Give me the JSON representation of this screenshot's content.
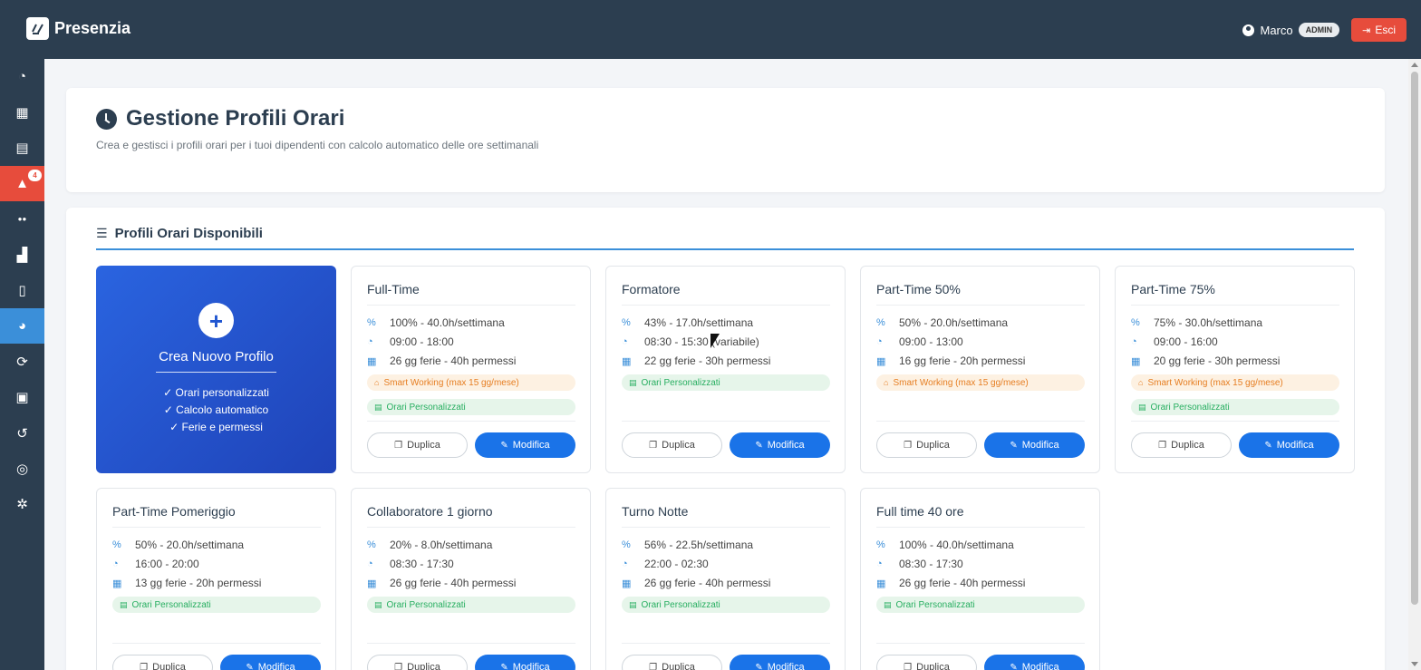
{
  "app": {
    "brand": "Presenzia"
  },
  "header": {
    "user_name": "Marco",
    "role_badge": "ADMIN",
    "exit_label": "Esci"
  },
  "sidebar": {
    "items": [
      {
        "icon": "dashboard-icon",
        "glyph": "◔"
      },
      {
        "icon": "calendar-icon",
        "glyph": "▦"
      },
      {
        "icon": "clipboard-icon",
        "glyph": "▤"
      },
      {
        "icon": "alert-icon",
        "glyph": "▲",
        "badge": "4"
      },
      {
        "icon": "users-icon",
        "glyph": "●●"
      },
      {
        "icon": "chart-icon",
        "glyph": "▟"
      },
      {
        "icon": "invoice-icon",
        "glyph": "▯"
      },
      {
        "icon": "user-clock-icon",
        "glyph": "◕"
      },
      {
        "icon": "sync-icon",
        "glyph": "⟳"
      },
      {
        "icon": "qr-icon",
        "glyph": "▣"
      },
      {
        "icon": "history-icon",
        "glyph": "↺"
      },
      {
        "icon": "support-icon",
        "glyph": "◎"
      },
      {
        "icon": "settings-icon",
        "glyph": "✲"
      }
    ]
  },
  "page": {
    "title": "Gestione Profili Orari",
    "subtitle": "Crea e gestisci i profili orari per i tuoi dipendenti con calcolo automatico delle ore settimanali"
  },
  "section": {
    "title": "Profili Orari Disponibili"
  },
  "create_card": {
    "title": "Crea Nuovo Profilo",
    "features": [
      "Orari personalizzati",
      "Calcolo automatico",
      "Ferie e permessi"
    ]
  },
  "buttons": {
    "duplicate": "Duplica",
    "edit": "Modifica"
  },
  "tags": {
    "smart_working": "Smart Working (max 15 gg/mese)",
    "custom_hours": "Orari Personalizzati"
  },
  "profiles": [
    {
      "name": "Full-Time",
      "percent": "100% - 40.0h/settimana",
      "hours": "09:00 - 18:00",
      "leave": "26 gg ferie - 40h permessi",
      "smart_working": true
    },
    {
      "name": "Formatore",
      "percent": "43% - 17.0h/settimana",
      "hours": "08:30 - 15:30 (variabile)",
      "leave": "22 gg ferie - 30h permessi",
      "smart_working": false
    },
    {
      "name": "Part-Time 50%",
      "percent": "50% - 20.0h/settimana",
      "hours": "09:00 - 13:00",
      "leave": "16 gg ferie - 20h permessi",
      "smart_working": true,
      "custom_hidden": true
    },
    {
      "name": "Part-Time 75%",
      "percent": "75% - 30.0h/settimana",
      "hours": "09:00 - 16:00",
      "leave": "20 gg ferie - 30h permessi",
      "smart_working": true
    },
    {
      "name": "Part-Time Pomeriggio",
      "percent": "50% - 20.0h/settimana",
      "hours": "16:00 - 20:00",
      "leave": "13 gg ferie - 20h permessi",
      "smart_working": false
    },
    {
      "name": "Collaboratore 1 giorno",
      "percent": "20% - 8.0h/settimana",
      "hours": "08:30 - 17:30",
      "leave": "26 gg ferie - 40h permessi",
      "smart_working": false
    },
    {
      "name": "Turno Notte",
      "percent": "56% - 22.5h/settimana",
      "hours": "22:00 - 02:30",
      "leave": "26 gg ferie - 40h permessi",
      "smart_working": false
    },
    {
      "name": "Full time 40 ore",
      "percent": "100% - 40.0h/settimana",
      "hours": "08:30 - 17:30",
      "leave": "26 gg ferie - 40h permessi",
      "smart_working": false
    }
  ]
}
